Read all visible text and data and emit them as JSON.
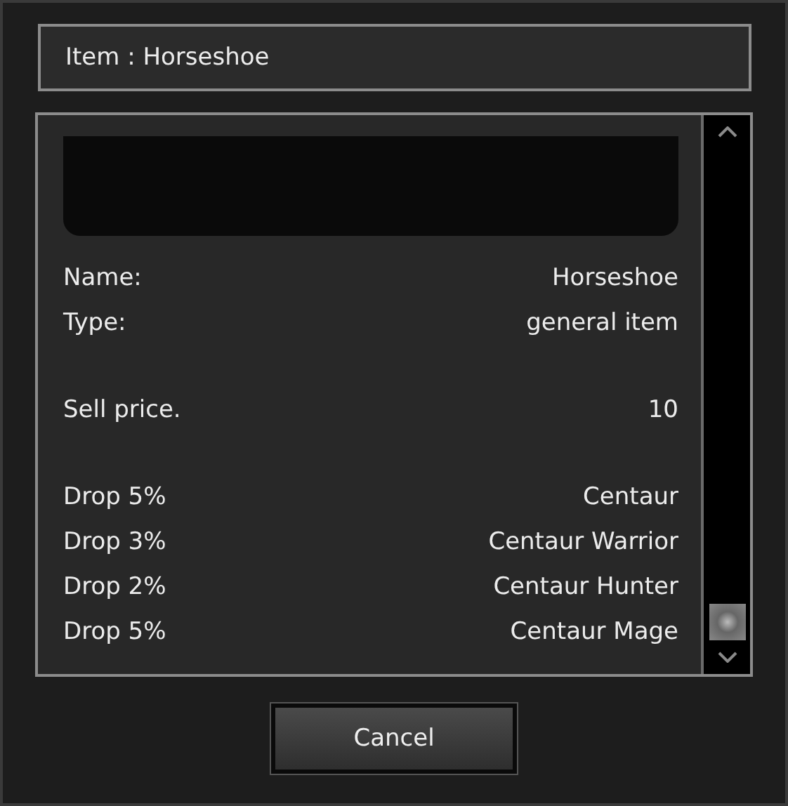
{
  "window": {
    "title": "Item : Horseshoe"
  },
  "sections": [
    {
      "rows": [
        {
          "label": "Name:",
          "value": "Horseshoe"
        },
        {
          "label": "Type:",
          "value": "general item"
        }
      ]
    },
    {
      "rows": [
        {
          "label": "Sell price.",
          "value": "10"
        }
      ]
    },
    {
      "rows": [
        {
          "label": "Drop 5%",
          "value": "Centaur"
        },
        {
          "label": "Drop 3%",
          "value": "Centaur Warrior"
        },
        {
          "label": "Drop 2%",
          "value": "Centaur Hunter"
        },
        {
          "label": "Drop 5%",
          "value": "Centaur Mage"
        }
      ]
    }
  ],
  "buttons": [
    "Cancel"
  ]
}
